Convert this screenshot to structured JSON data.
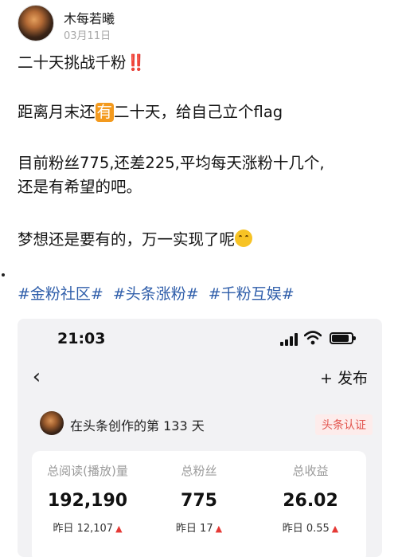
{
  "post": {
    "author": "木每若曦",
    "date": "03月11日",
    "line1": "二十天挑战千粉",
    "line1_marks": "‼️",
    "line2_a": "距离月末还",
    "line2_emoji": "有",
    "line2_b": "二十天，给自己立个flag",
    "line3": "目前粉丝775,还差225,平均每天涨粉十几个,",
    "line3b": "还是有希望的吧。",
    "line4": "梦想还是要有的，万一实现了呢",
    "tags": [
      "#金粉社区#",
      "#头条涨粉#",
      "#千粉互娱#"
    ]
  },
  "phone": {
    "time": "21:03",
    "publish_label": "+ 发布",
    "creator_text": "在头条创作的第 133 天",
    "verify_label": "头条认证",
    "stats": [
      {
        "label": "总阅读(播放)量",
        "value": "192,190",
        "delta": "昨日 12,107"
      },
      {
        "label": "总粉丝",
        "value": "775",
        "delta": "昨日 17"
      },
      {
        "label": "总收益",
        "value": "26.02",
        "delta": "昨日 0.55"
      }
    ]
  },
  "icons": {
    "back": "chevron-left-icon",
    "signal": "signal-icon",
    "wifi": "wifi-icon",
    "battery": "battery-icon",
    "up": "up-arrow-icon",
    "smiley": "smiley-icon"
  },
  "colors": {
    "tag": "#2f5eaa",
    "accent_red": "#e53935",
    "emoji_orange": "#f39a1e",
    "verify_bg": "#fdeceb"
  }
}
